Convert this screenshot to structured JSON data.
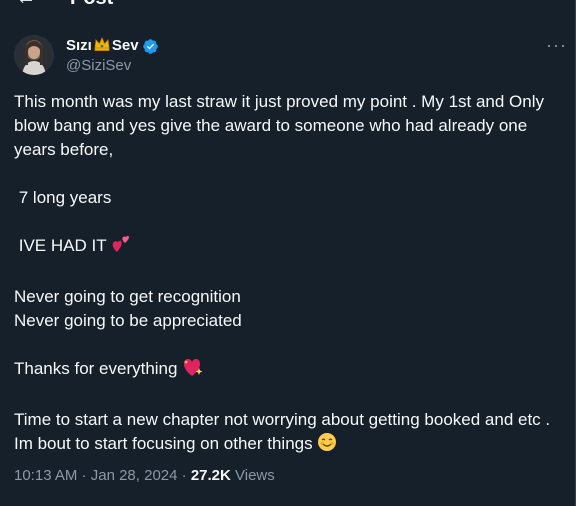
{
  "header": {
    "title": "Post",
    "back_icon": "back-arrow-icon"
  },
  "post": {
    "author": {
      "name_part1": "Sızı",
      "name_part2": "Sev",
      "crown_icon": "crown-icon",
      "handle": "@SiziSev",
      "verified": true
    },
    "more_icon": "more-icon",
    "text": {
      "p1": "This month was my last straw it just proved my point . My 1st and Only blow bang and yes give the award to someone who had already one years before,",
      "p2": " 7 long years",
      "p3": " IVE HAD IT ",
      "p4_line1": "Never going to get recognition",
      "p4_line2": "Never going to be appreciated",
      "p5": "Thanks for everything ",
      "p6_line1": "Time to start a new chapter not worrying about getting booked and etc .",
      "p6_line2": "Im bout to start focusing on other things "
    },
    "meta": {
      "time": "10:13 AM",
      "sep1": " · ",
      "date": "Jan 28, 2024",
      "sep2": " · ",
      "views_count": "27.2K",
      "views_label": " Views"
    }
  },
  "colors": {
    "background": "#15202b",
    "text": "#f7f9f9",
    "secondary": "#8b98a5",
    "verified": "#1d9bf0",
    "heart": "#e0245e"
  }
}
